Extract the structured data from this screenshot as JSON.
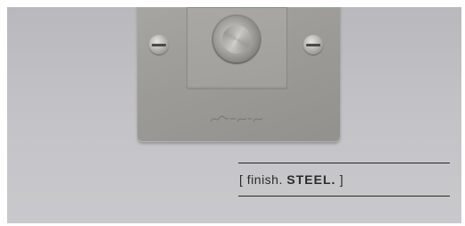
{
  "caption": {
    "open_bracket": "[",
    "word": "finish.",
    "emphasis": "STEEL.",
    "close_bracket": "]"
  },
  "plate": {
    "finish_color": "#9c9b97",
    "brand_mark": "Buster + Punch"
  },
  "colors": {
    "wall": "#c4c4c8",
    "text": "#2b2b2b"
  }
}
